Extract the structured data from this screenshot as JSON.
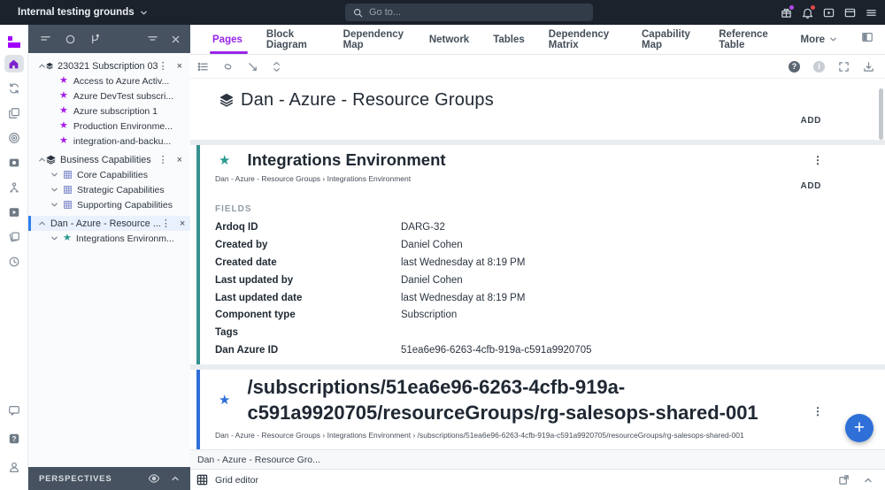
{
  "colors": {
    "brand_purple": "#a100ff",
    "active_tab_purple": "#9a25e8",
    "accent_teal": "#2a9a8f",
    "accent_blue": "#2e6fd8",
    "link_blue": "#4596e0",
    "fab_blue": "#2e6fd8",
    "notification_red": "#e5484d",
    "topbar_bg": "#1b222c",
    "panel_header_bg": "#46525f"
  },
  "icons": {
    "star": "★",
    "kebab": "⋮",
    "close": "×",
    "question": "?",
    "info": "i",
    "plus": "+"
  },
  "topbar": {
    "org_name": "Internal testing grounds",
    "search_placeholder": "Go to..."
  },
  "tabs": [
    "Pages",
    "Block Diagram",
    "Dependency Map",
    "Network",
    "Tables",
    "Dependency Matrix",
    "Capability Map",
    "Reference Table",
    "More"
  ],
  "navigator": {
    "perspectives_label": "PERSPECTIVES",
    "ws": [
      {
        "label": "230321 Subscription 03",
        "children": [
          "Access to Azure Activ...",
          "Azure DevTest subscri...",
          "Azure subscription 1",
          "Production Environme...",
          "integration-and-backu..."
        ]
      },
      {
        "label": "Business Capabilities",
        "children": [
          "Core Capabilities",
          "Strategic Capabilities",
          "Supporting Capabilities"
        ]
      },
      {
        "label": "Dan - Azure - Resource ...",
        "children": [
          "Integrations Environm..."
        ]
      }
    ]
  },
  "page": {
    "title": "Dan - Azure - Resource Groups",
    "add_label": "ADD"
  },
  "component": {
    "title": "Integrations Environment",
    "breadcrumb": "Dan - Azure - Resource Groups › Integrations Environment",
    "add_label": "ADD",
    "fields_heading": "FIELDS",
    "fields": [
      {
        "label": "Ardoq ID",
        "value": "DARG-32"
      },
      {
        "label": "Created by",
        "value": "Daniel Cohen"
      },
      {
        "label": "Created date",
        "value": "last Wednesday at 8:19 PM"
      },
      {
        "label": "Last updated by",
        "value": "Daniel Cohen"
      },
      {
        "label": "Last updated date",
        "value": "last Wednesday at 8:19 PM"
      },
      {
        "label": "Component type",
        "value": "Subscription"
      },
      {
        "label": "Tags",
        "value": ""
      },
      {
        "label": "Dan Azure ID",
        "value": "51ea6e96-6263-4cfb-919a-c591a9920705"
      }
    ]
  },
  "resource": {
    "title": "/subscriptions/51ea6e96-6263-4cfb-919a-c591a9920705/resourceGroups/rg-salesops-shared-001",
    "breadcrumb": "Dan - Azure - Resource Groups › Integrations Environment › /subscriptions/51ea6e96-6263-4cfb-919a-c591a9920705/resourceGroups/rg-salesops-shared-001"
  },
  "statusbar": {
    "context": "Dan - Azure - Resource Gro...",
    "editor_label": "Grid editor"
  }
}
